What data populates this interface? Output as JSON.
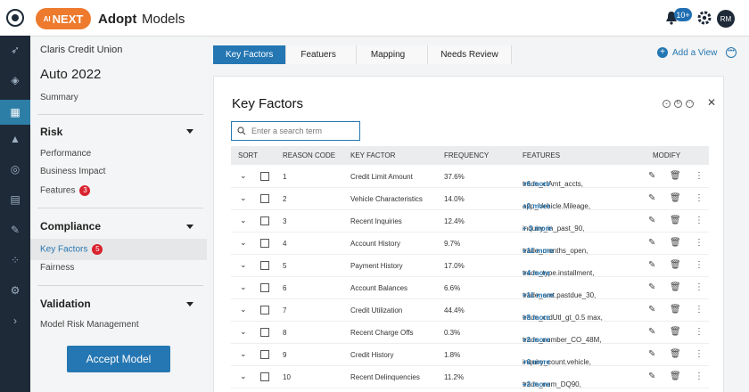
{
  "app": {
    "brand": "NEXT",
    "brand_prefix": "AI",
    "nav": [
      "Adopt",
      "Models"
    ],
    "notifications": "10+",
    "user_initials": "RM"
  },
  "left": {
    "org": "Claris Credit Union",
    "model": "Auto 2022",
    "summary": "Summary",
    "sections": [
      {
        "title": "Risk",
        "items": [
          {
            "label": "Performance"
          },
          {
            "label": "Business Impact"
          },
          {
            "label": "Features",
            "badge": "3"
          }
        ]
      },
      {
        "title": "Compliance",
        "items": [
          {
            "label": "Key Factors",
            "badge": "5",
            "selected": true
          },
          {
            "label": "Fairness"
          }
        ]
      },
      {
        "title": "Validation",
        "items": [
          {
            "label": "Model Risk Management"
          }
        ]
      }
    ],
    "accept": "Accept Model"
  },
  "tabs": [
    "Key Factors",
    "Featuers",
    "Mapping",
    "Needs Review"
  ],
  "add_view": "Add a View",
  "card": {
    "title": "Key Factors",
    "search_placeholder": "Enter a search term",
    "columns": [
      "SORT",
      "REASON CODE",
      "KEY FACTOR",
      "FREQUENCY",
      "FEATURES",
      "MODIFY"
    ],
    "rows": [
      {
        "code": "1",
        "factor": "Credit Limit Amount",
        "freq": "37.6%",
        "feature": "trade_clAmt_accts,",
        "more": "+6 more"
      },
      {
        "code": "2",
        "factor": "Vehicle Characteristics",
        "freq": "14.0%",
        "feature": "app_Vehicle.Mileage,",
        "more": "+2 more"
      },
      {
        "code": "3",
        "factor": "Recent Inquiries",
        "freq": "12.4%",
        "feature": "inquiry_in_past_90,",
        "more": "+ 3 more"
      },
      {
        "code": "4",
        "factor": "Account History",
        "freq": "9.7%",
        "feature": "trade_months_open,",
        "more": "+11 more"
      },
      {
        "code": "5",
        "factor": "Payment History",
        "freq": "17.0%",
        "feature": "trade_type.installment,",
        "more": "+4 more"
      },
      {
        "code": "6",
        "factor": "Account Balances",
        "freq": "6.6%",
        "feature": "trade_amt.pastdue_30,",
        "more": "+11 more"
      },
      {
        "code": "7",
        "factor": "Credit Utilization",
        "freq": "44.4%",
        "feature": "trade_crdUtl_gt_0.5 max,",
        "more": "+8 more"
      },
      {
        "code": "8",
        "factor": "Recent Charge Offs",
        "freq": "0.3%",
        "feature": "trade_number_CO_48M,",
        "more": "+2 more"
      },
      {
        "code": "9",
        "factor": "Credit History",
        "freq": "1.8%",
        "feature": "inquiry_count.vehicle,",
        "more": "+6 more"
      },
      {
        "code": "10",
        "factor": "Recent Delinquencies",
        "freq": "11.2%",
        "feature": "trade_num_DQ90,",
        "more": "+2 more"
      }
    ]
  },
  "colors": {
    "primary": "#2577b3",
    "rail": "#1e2a38",
    "badge_red": "#d9232e",
    "brand": "#ee7a2d"
  }
}
